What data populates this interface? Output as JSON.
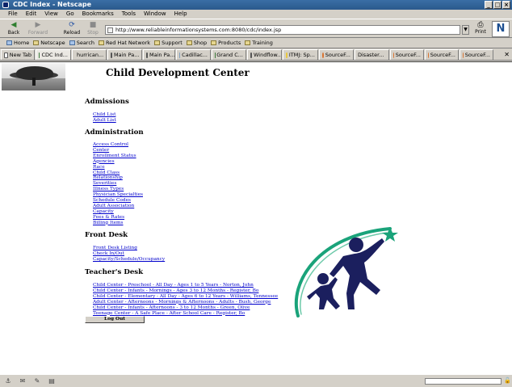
{
  "window": {
    "title": "CDC Index - Netscape"
  },
  "menu": [
    "File",
    "Edit",
    "View",
    "Go",
    "Bookmarks",
    "Tools",
    "Window",
    "Help"
  ],
  "nav": {
    "back": "Back",
    "forward": "Forward",
    "reload": "Reload",
    "stop": "Stop",
    "url": "http://www.reliableinformationsystems.com:8080/cdc/index.jsp",
    "print": "Print"
  },
  "personal_toolbar": [
    "Home",
    "Netscape",
    "Search",
    "Red Hat Network",
    "Support",
    "Shop",
    "Products",
    "Training"
  ],
  "tabs": [
    "New Tab",
    "CDC Ind...",
    "hurrican...",
    "Main Pa...",
    "Main Pa...",
    "Cadillac...",
    "Grand C...",
    "Windflow...",
    "ITMJ: Sp...",
    "SourceF...",
    "Disaster...",
    "SourceF...",
    "SourceF...",
    "SourceF..."
  ],
  "page": {
    "title": "Child Development Center",
    "sections": {
      "admissions": {
        "heading": "Admissions",
        "links": [
          "Child List",
          "Adult List"
        ]
      },
      "administration": {
        "heading": "Administration",
        "links": [
          "Access Control",
          "Center",
          "Enrollment Status",
          "Agencies",
          "Race",
          "Child Class",
          "Relationship",
          "Severities",
          "Illness Types",
          "Physician Specialties",
          "Schedule Codes",
          "Adult Association",
          "Capacity",
          "Fees & Rates",
          "Billing Items"
        ]
      },
      "front_desk": {
        "heading": "Front Desk",
        "links": [
          "Front Desk Listing",
          "Check In/Out",
          "Capacity/Schedule/Occupancy"
        ]
      },
      "teachers_desk": {
        "heading": "Teacher's Desk",
        "links": [
          "Child Center - Preschool - All Day - Ages 1 to 5 Years - Norton, John",
          "Child Center - Infants - Mornings - Ages 3 to 12 Months - Register, Bo",
          "Child Center - Elementary - All Day - Ages 6 to 12 Years - Williams, Tennessee",
          "Adult Center - Afternoons - Mornings & Afternoons - Adults - Bush, George",
          "Child Center - Infants - Afternoons - 3 to 12 Months - Green, Olive",
          "Teenage Center - A Safe Place - After School Care - Register, Bo"
        ]
      }
    },
    "logout": "Log Out"
  },
  "colors": {
    "link": "#0000cc",
    "logo_navy": "#1b1f5e",
    "logo_teal": "#1aa37a",
    "titlebar": "#3a6ea5"
  }
}
